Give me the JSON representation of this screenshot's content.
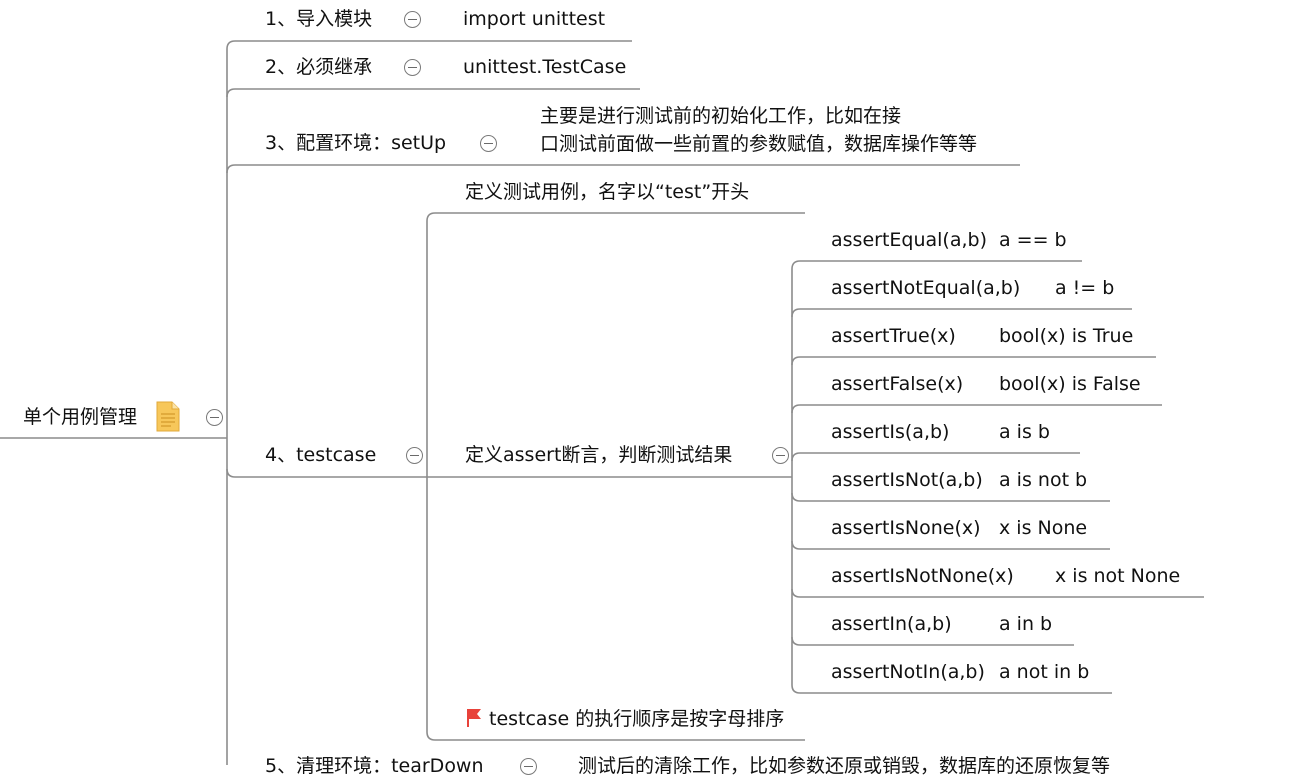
{
  "root": {
    "label": "单个用例管理",
    "icon": "note-icon",
    "color": "#f5c04a"
  },
  "branches": {
    "b1": {
      "label": "1、导入模块",
      "detail": "import unittest"
    },
    "b2": {
      "label": "2、必须继承",
      "detail": "unittest.TestCase"
    },
    "b3": {
      "label": "3、配置环境：setUp",
      "detail_line1": "主要是进行测试前的初始化工作，比如在接",
      "detail_line2": "口测试前面做一些前置的参数赋值，数据库操作等等"
    },
    "b4": {
      "label": "4、testcase",
      "define": "定义测试用例，名字以“test”开头",
      "assert_label": "定义assert断言，判断测试结果",
      "asserts": [
        {
          "method": "assertEqual(a,b)",
          "meaning": "a == b"
        },
        {
          "method": "assertNotEqual(a,b)",
          "meaning": "a != b"
        },
        {
          "method": "assertTrue(x)",
          "meaning": "bool(x) is True"
        },
        {
          "method": "assertFalse(x)",
          "meaning": "bool(x) is False"
        },
        {
          "method": "assertIs(a,b)",
          "meaning": "a is b"
        },
        {
          "method": "assertIsNot(a,b)",
          "meaning": "a is not b"
        },
        {
          "method": "assertIsNone(x)",
          "meaning": "x is None"
        },
        {
          "method": "assertIsNotNone(x)",
          "meaning": "x is not None"
        },
        {
          "method": "assertIn(a,b)",
          "meaning": "a in b"
        },
        {
          "method": "assertNotIn(a,b)",
          "meaning": "a not in b"
        }
      ],
      "order_note": "testcase 的执行顺序是按字母排序",
      "flag_icon": "flag-icon",
      "flag_color": "#e8423a"
    },
    "b5": {
      "label": "5、清理环境：tearDown",
      "detail": "测试后的清除工作，比如参数还原或销毁，数据库的还原恢复等"
    }
  },
  "line_color": "#8c8c8c"
}
